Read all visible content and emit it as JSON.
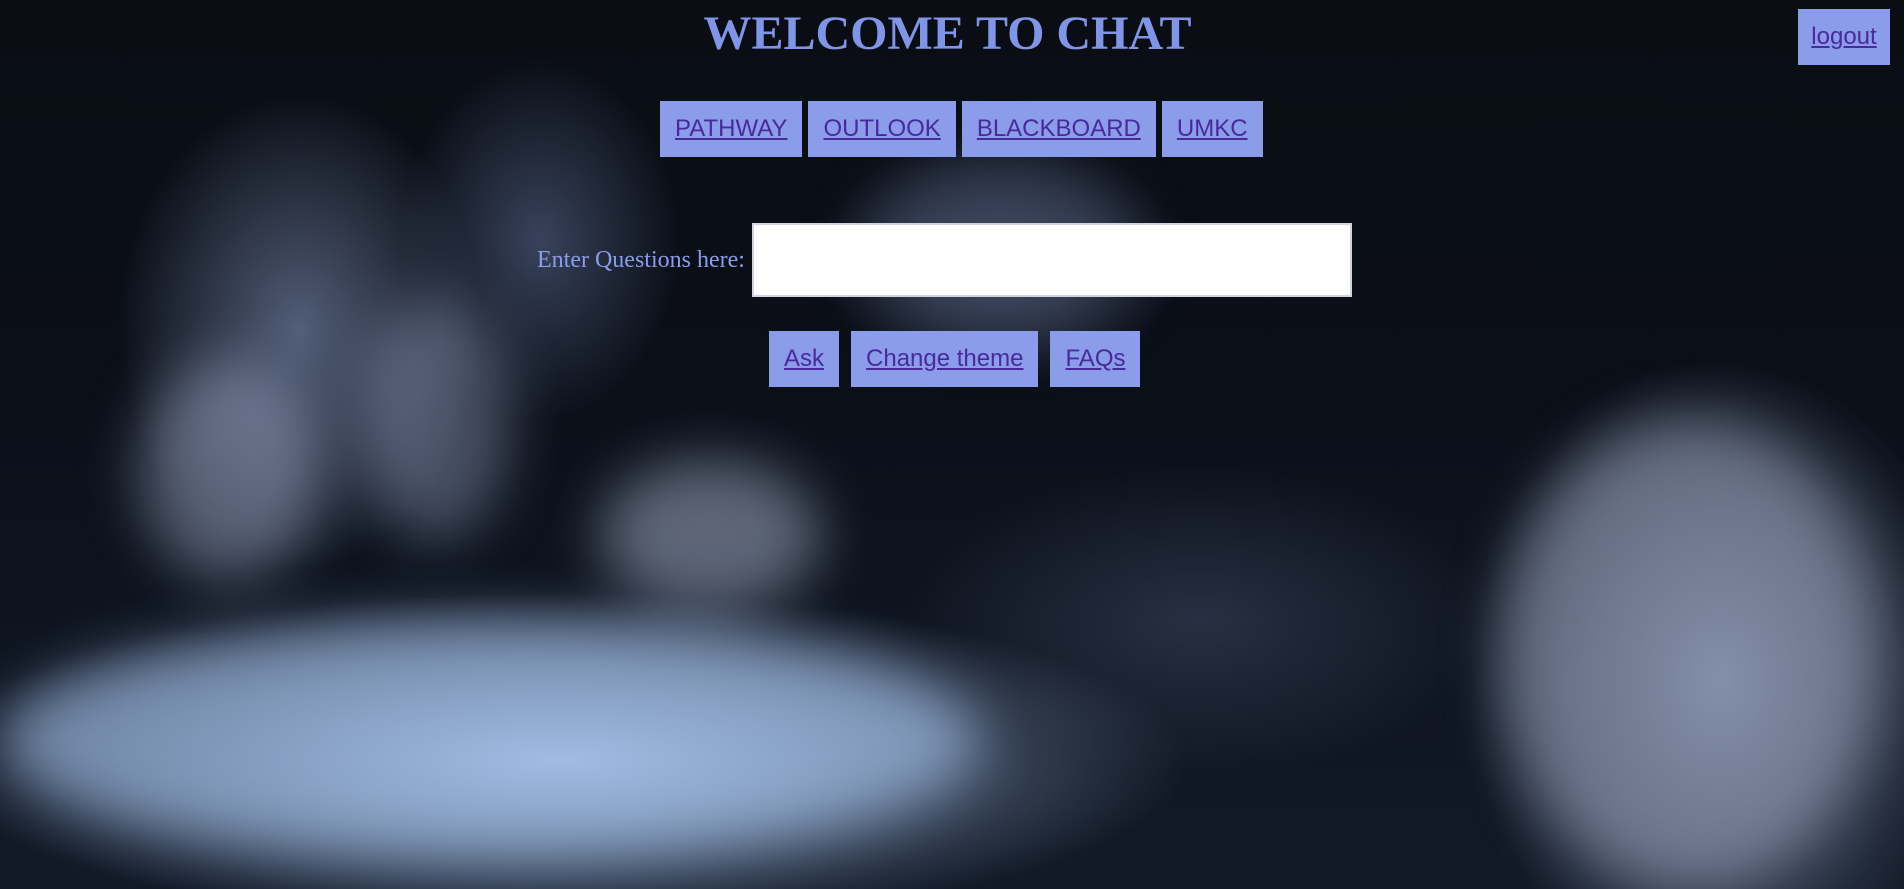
{
  "header": {
    "title": "WELCOME TO CHAT",
    "logout_label": "logout"
  },
  "nav": {
    "items": [
      {
        "label": "PATHWAY"
      },
      {
        "label": "OUTLOOK"
      },
      {
        "label": "BLACKBOARD"
      },
      {
        "label": "UMKC"
      }
    ]
  },
  "question": {
    "label": "Enter Questions here:",
    "value": "",
    "placeholder": ""
  },
  "actions": {
    "ask_label": "Ask",
    "theme_label": "Change theme",
    "faqs_label": "FAQs"
  },
  "colors": {
    "accent": "#8a9cea",
    "link_text": "#4a2a9a",
    "title": "#8094e8"
  }
}
